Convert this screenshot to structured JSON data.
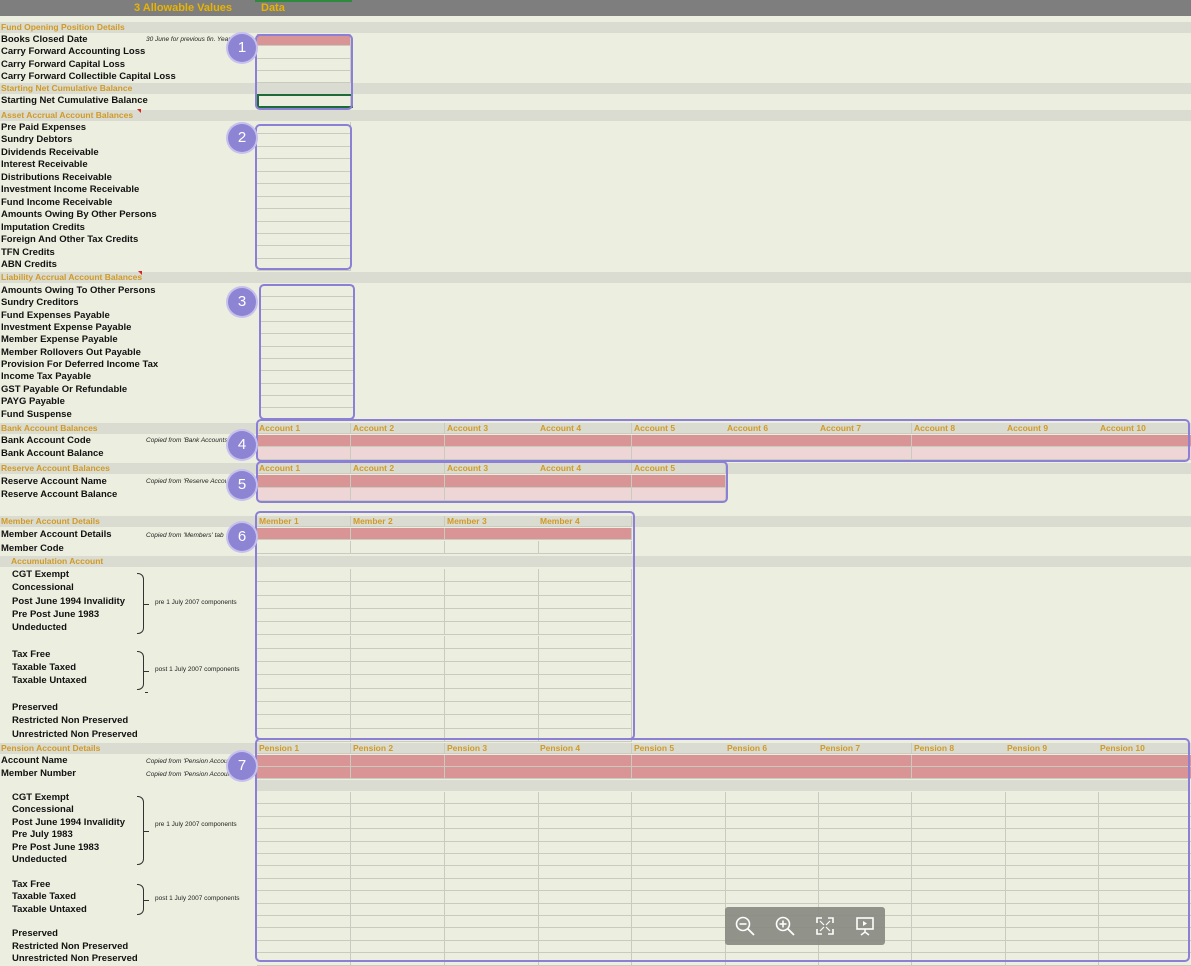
{
  "header": {
    "col_a": "3 Allowable Values",
    "col_b": "Data"
  },
  "sections": {
    "fund_opening": "Fund Opening Position Details",
    "starting_net": "Starting Net Cumulative Balance",
    "asset_accrual": "Asset Accrual Account Balances",
    "liability_accrual": "Liability Accrual Account Balances",
    "bank": "Bank Account Balances",
    "reserve": "Reserve Account Balances",
    "member": "Member Account Details",
    "accumulation": "Accumulation Account",
    "pension": "Pension Account Details"
  },
  "fund_rows": [
    "Books Closed Date",
    "Carry Forward Accounting Loss",
    "Carry Forward Capital Loss",
    "Carry Forward Collectible Capital Loss"
  ],
  "books_closed_note": "30 June for previous fin. Year",
  "starting_row": "Starting Net Cumulative Balance",
  "asset_rows": [
    "Pre Paid Expenses",
    "Sundry Debtors",
    "Dividends Receivable",
    "Interest Receivable",
    "Distributions Receivable",
    "Investment Income Receivable",
    "Fund Income Receivable",
    "Amounts Owing By Other Persons",
    "Imputation Credits",
    "Foreign And Other Tax Credits",
    "TFN Credits",
    "ABN Credits"
  ],
  "liability_rows": [
    "Amounts Owing To Other Persons",
    "Sundry Creditors",
    "Fund Expenses Payable",
    "Investment Expense Payable",
    "Member Expense Payable",
    "Member Rollovers Out Payable",
    "Provision For Deferred Income Tax",
    "Income Tax Payable",
    "GST Payable Or Refundable",
    "PAYG Payable",
    "Fund Suspense"
  ],
  "bank_rows": [
    "Bank Account Code",
    "Bank Account Balance"
  ],
  "bank_note": "Copied from 'Bank Accounts'",
  "bank_cols": [
    "Account 1",
    "Account 2",
    "Account 3",
    "Account 4",
    "Account 5",
    "Account 6",
    "Account 7",
    "Account 8",
    "Account 9",
    "Account 10"
  ],
  "reserve_rows": [
    "Reserve Account Name",
    "Reserve Account Balance"
  ],
  "reserve_note": "Copied from 'Reserve Accounts'",
  "reserve_cols": [
    "Account 1",
    "Account 2",
    "Account 3",
    "Account 4",
    "Account 5"
  ],
  "member_rows": [
    "Member Account Details",
    "Member Code"
  ],
  "member_note": "Copied from 'Members' tab",
  "member_cols": [
    "Member 1",
    "Member 2",
    "Member 3",
    "Member 4"
  ],
  "accum_pre": [
    "CGT Exempt",
    "Concessional",
    "Post June 1994 Invalidity",
    "Pre Post June 1983",
    "Undeducted"
  ],
  "accum_post": [
    "Tax Free",
    "Taxable Taxed",
    "Taxable Untaxed"
  ],
  "accum_pres": [
    "Preserved",
    "Restricted Non Preserved",
    "Unrestricted Non Preserved"
  ],
  "pre_label": "pre 1 July 2007 components",
  "post_label": "post 1 July 2007 components",
  "pension_cols": [
    "Pension 1",
    "Pension 2",
    "Pension 3",
    "Pension 4",
    "Pension 5",
    "Pension 6",
    "Pension 7",
    "Pension 8",
    "Pension 9",
    "Pension 10"
  ],
  "pension_rows": [
    "Account Name",
    "Member Number"
  ],
  "pension_note1": "Copied from 'Pension Accounts' tab",
  "pension_note2": "Copied from 'Pension Accounts' tab",
  "pension_pre": [
    "CGT Exempt",
    "Concessional",
    "Post June 1994 Invalidity",
    "Pre July 1983",
    "Pre Post June 1983",
    "Undeducted"
  ],
  "pension_post": [
    "Tax Free",
    "Taxable Taxed",
    "Taxable Untaxed"
  ],
  "pension_pres": [
    "Preserved",
    "Restricted Non Preserved",
    "Unrestricted Non Preserved"
  ],
  "badges": [
    "1",
    "2",
    "3",
    "4",
    "5",
    "6",
    "7"
  ],
  "toolbar": {
    "zoom_out": "zoom-out-icon",
    "zoom_in": "zoom-in-icon",
    "fit": "fit-screen-icon",
    "present": "presentation-icon"
  }
}
